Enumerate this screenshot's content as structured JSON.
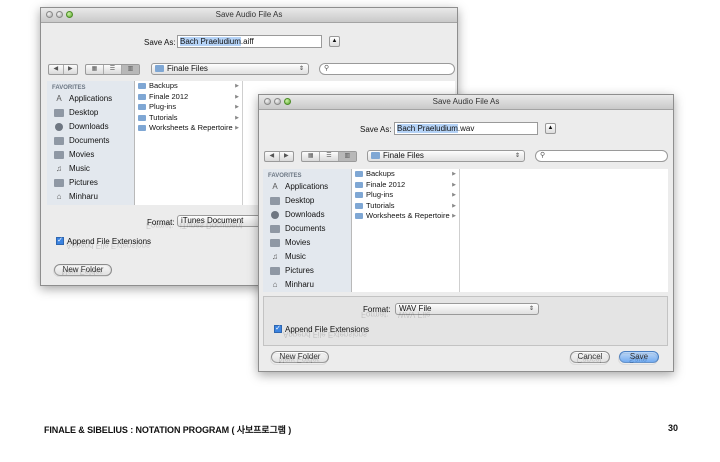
{
  "back_dialog": {
    "title": "Save Audio File As",
    "save_as_label": "Save As:",
    "filename_selected": "Bach Praeludium",
    "filename_ext": ".aiff",
    "location": "Finale Files",
    "favorites_header": "FAVORITES",
    "sidebar": [
      "Applications",
      "Desktop",
      "Downloads",
      "Documents",
      "Movies",
      "Music",
      "Pictures",
      "Minharu"
    ],
    "files": [
      "Backups",
      "Finale 2012",
      "Plug-ins",
      "Tutorials",
      "Worksheets & Repertoire"
    ],
    "format_label": "Format:",
    "format_value": "iTunes Document",
    "append_label": "Append File Extensions",
    "new_folder": "New Folder"
  },
  "front_dialog": {
    "title": "Save Audio File As",
    "save_as_label": "Save As:",
    "filename_selected": "Bach Praeludium",
    "filename_ext": ".wav",
    "location": "Finale Files",
    "favorites_header": "FAVORITES",
    "sidebar": [
      "Applications",
      "Desktop",
      "Downloads",
      "Documents",
      "Movies",
      "Music",
      "Pictures",
      "Minharu"
    ],
    "files": [
      "Backups",
      "Finale 2012",
      "Plug-ins",
      "Tutorials",
      "Worksheets & Repertoire"
    ],
    "format_label": "Format:",
    "format_value": "WAV File",
    "append_label": "Append File Extensions",
    "new_folder": "New Folder",
    "cancel": "Cancel",
    "save": "Save"
  },
  "reflection": {
    "new_folder": "New Folder",
    "append_label": "Append File Extensions",
    "format_label": "Format:",
    "format_back": "iTunes Document",
    "format_front": "WAV File",
    "cancel": "Cancel",
    "save": "Save"
  },
  "footer": {
    "text": "FINALE & SIBELIUS : NOTATION PROGRAM ( 사보프로그램 )",
    "page": "30"
  }
}
